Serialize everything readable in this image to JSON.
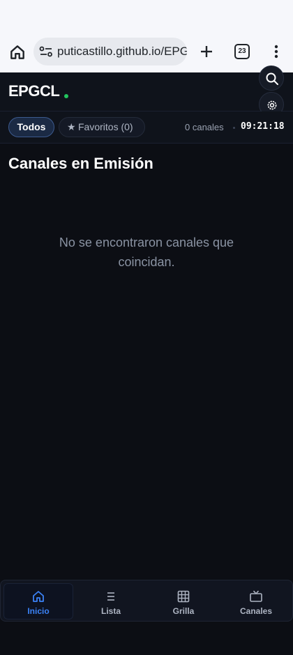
{
  "browser": {
    "url": "puticastillo.github.io/EPG",
    "tab_count": "23"
  },
  "header": {
    "logo_text": "EPGCL",
    "accent_color": "#22c55e"
  },
  "filters": {
    "all_label": "Todos",
    "favorites_label": "Favoritos (0)",
    "channel_count": "0 canales",
    "clock": "09:21:18"
  },
  "main": {
    "title": "Canales en Emisión",
    "empty_message": "No se encontraron canales que coincidan."
  },
  "bottom_nav": {
    "items": [
      {
        "label": "Inicio",
        "icon": "home-icon",
        "active": true
      },
      {
        "label": "Lista",
        "icon": "list-icon",
        "active": false
      },
      {
        "label": "Grilla",
        "icon": "grid-icon",
        "active": false
      },
      {
        "label": "Canales",
        "icon": "tv-icon",
        "active": false
      }
    ],
    "active_color": "#3b82f6"
  }
}
